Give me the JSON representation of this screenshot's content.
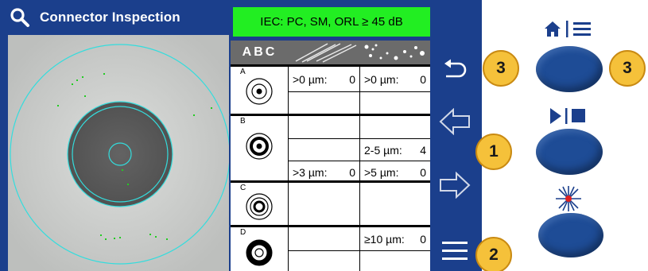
{
  "title_bar": {
    "icon": "magnifier-icon",
    "title": "Connector Inspection"
  },
  "standard_banner": "IEC: PC, SM, ORL ≥ 45 dB",
  "results_table": {
    "header_zone_letters": "ABC",
    "header_scratches_icon": "scratches-icon",
    "header_defects_icon": "defects-icon",
    "zones": [
      {
        "letter": "A",
        "scratch_rows": [
          {
            "label": ">0 µm:",
            "count": "0"
          },
          {
            "label": "",
            "count": ""
          }
        ],
        "defect_rows": [
          {
            "label": ">0 µm:",
            "count": "0"
          },
          {
            "label": "",
            "count": ""
          }
        ]
      },
      {
        "letter": "B",
        "scratch_rows": [
          {
            "label": "",
            "count": ""
          },
          {
            "label": "",
            "count": ""
          },
          {
            "label": ">3 µm:",
            "count": "0"
          }
        ],
        "defect_rows": [
          {
            "label": "",
            "count": ""
          },
          {
            "label": "2-5 µm:",
            "count": "4"
          },
          {
            "label": ">5 µm:",
            "count": "0"
          }
        ]
      },
      {
        "letter": "C",
        "scratch_rows": [
          {
            "label": "",
            "count": ""
          }
        ],
        "defect_rows": [
          {
            "label": "",
            "count": ""
          }
        ]
      },
      {
        "letter": "D",
        "scratch_rows": [
          {
            "label": "",
            "count": ""
          },
          {
            "label": "",
            "count": ""
          }
        ],
        "defect_rows": [
          {
            "label": "≥10 µm:",
            "count": "0"
          },
          {
            "label": "",
            "count": ""
          }
        ]
      }
    ]
  },
  "sidebar_buttons": [
    "back-arrow-icon",
    "left-arrow-icon",
    "right-arrow-icon",
    "menu-icon"
  ],
  "callouts": {
    "badge_back": "3",
    "badge_arrows": "1",
    "badge_menu": "2",
    "badge_home_button": "3"
  },
  "hardware_buttons": [
    {
      "icon": "home-menu-icon"
    },
    {
      "icon": "play-stop-icon"
    },
    {
      "icon": "laser-icon"
    }
  ],
  "colors": {
    "screen_blue": "#1b3f8c",
    "banner_green": "#22ee22",
    "overlay_cyan": "#33dddd",
    "defect_green": "#22cc22",
    "badge_yellow": "#f5c13a",
    "hardware_button_blue": "#1e4c96"
  }
}
